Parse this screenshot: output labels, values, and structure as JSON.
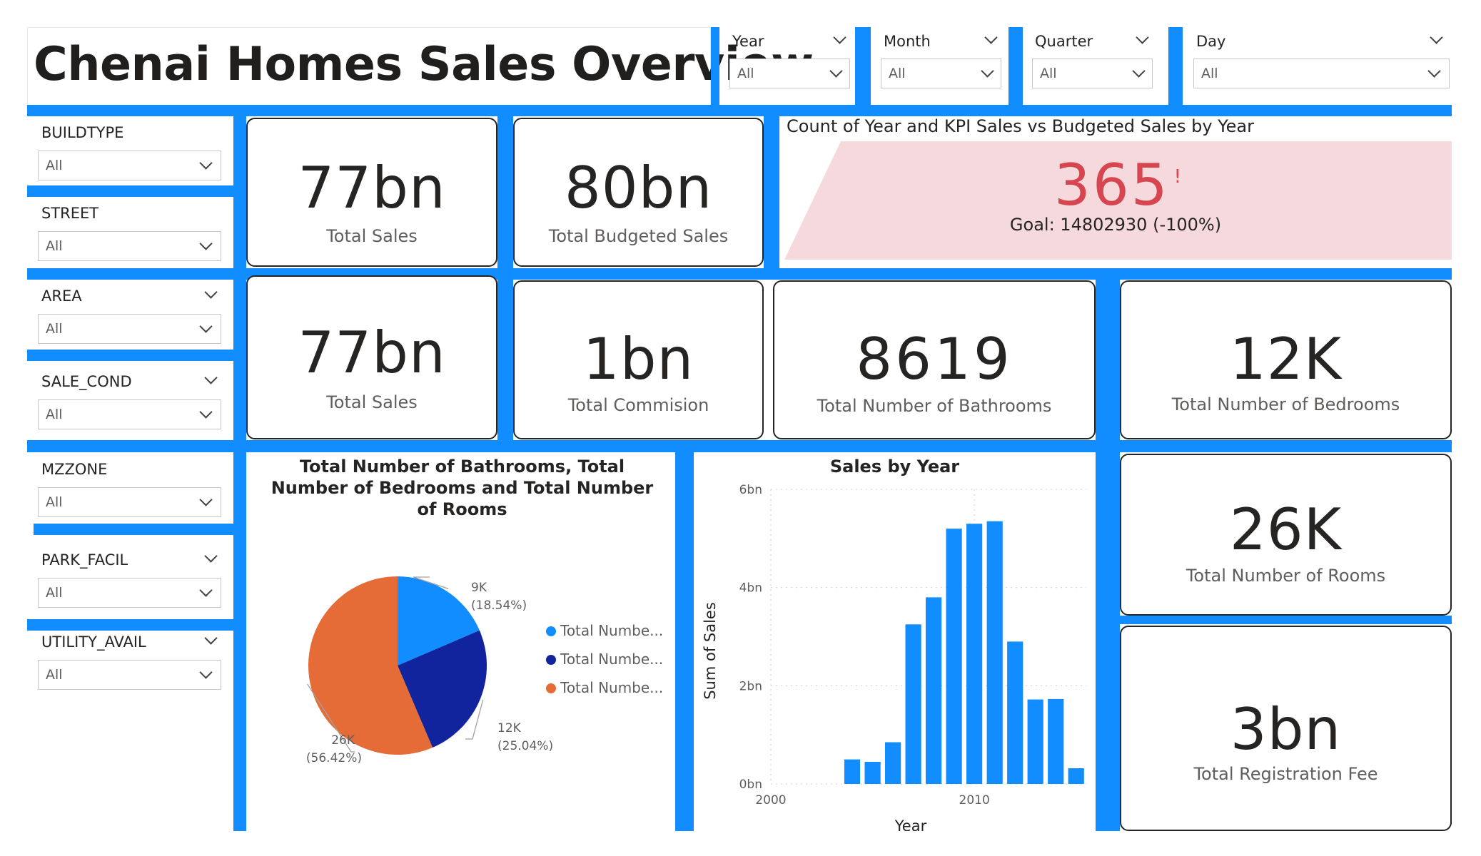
{
  "header": {
    "title": "Chenai Homes Sales Overview"
  },
  "top_slicers": [
    {
      "label": "Year",
      "value": "All"
    },
    {
      "label": "Month",
      "value": "All"
    },
    {
      "label": "Quarter",
      "value": "All"
    },
    {
      "label": "Day",
      "value": "All"
    }
  ],
  "side_slicers": [
    {
      "label": "BUILDTYPE",
      "value": "All"
    },
    {
      "label": "STREET",
      "value": "All"
    },
    {
      "label": "AREA",
      "value": "All"
    },
    {
      "label": "SALE_COND",
      "value": "All"
    },
    {
      "label": "MZZONE",
      "value": "All"
    },
    {
      "label": "PARK_FACIL",
      "value": "All"
    },
    {
      "label": "UTILITY_AVAIL",
      "value": "All"
    }
  ],
  "cards": {
    "total_sales_1": {
      "value": "77bn",
      "label": "Total Sales"
    },
    "total_budgeted": {
      "value": "80bn",
      "label": "Total Budgeted Sales"
    },
    "total_sales_2": {
      "value": "77bn",
      "label": "Total Sales"
    },
    "total_commission": {
      "value": "1bn",
      "label": "Total Commision"
    },
    "bathrooms": {
      "value": "8619",
      "label": "Total Number of Bathrooms"
    },
    "bedrooms": {
      "value": "12K",
      "label": "Total Number of Bedrooms"
    },
    "rooms": {
      "value": "26K",
      "label": "Total Number of Rooms"
    },
    "registration": {
      "value": "3bn",
      "label": "Total Registration Fee"
    }
  },
  "kpi": {
    "title": "Count of Year and KPI Sales vs Budgeted Sales by Year",
    "value": "365",
    "alert": "!",
    "goal": "Goal: 14802930 (-100%)",
    "colors": {
      "value": "#D64550",
      "band": "#F5D9DD"
    }
  },
  "chart_data": [
    {
      "type": "pie",
      "title": "Total Number of Bathrooms, Total Number of Bedrooms and Total Number of Rooms",
      "slices": [
        {
          "name": "Total Numbe...",
          "value": 8619,
          "display": "9K",
          "percent": "(18.54%)",
          "color": "#118DFF"
        },
        {
          "name": "Total Numbe...",
          "value": 11640,
          "display": "12K",
          "percent": "(25.04%)",
          "color": "#12239E"
        },
        {
          "name": "Total Numbe...",
          "value": 26220,
          "display": "26K",
          "percent": "(56.42%)",
          "color": "#E66C37"
        }
      ],
      "legend_position": "right"
    },
    {
      "type": "bar",
      "title": "Sales by Year",
      "xlabel": "Year",
      "ylabel": "Sum of Sales",
      "x_ticks": [
        "2000",
        "2010"
      ],
      "y_ticks": [
        "0bn",
        "2bn",
        "4bn",
        "6bn"
      ],
      "ylim": [
        0,
        6
      ],
      "xlim": [
        2000,
        2015.5
      ],
      "color": "#118DFF",
      "grid": true,
      "x": [
        2004,
        2005,
        2006,
        2007,
        2008,
        2009,
        2010,
        2011,
        2012,
        2013,
        2014,
        2015
      ],
      "values": [
        0.5,
        0.45,
        0.85,
        3.25,
        3.8,
        5.2,
        5.3,
        5.35,
        2.9,
        1.72,
        1.73,
        0.32
      ]
    }
  ]
}
